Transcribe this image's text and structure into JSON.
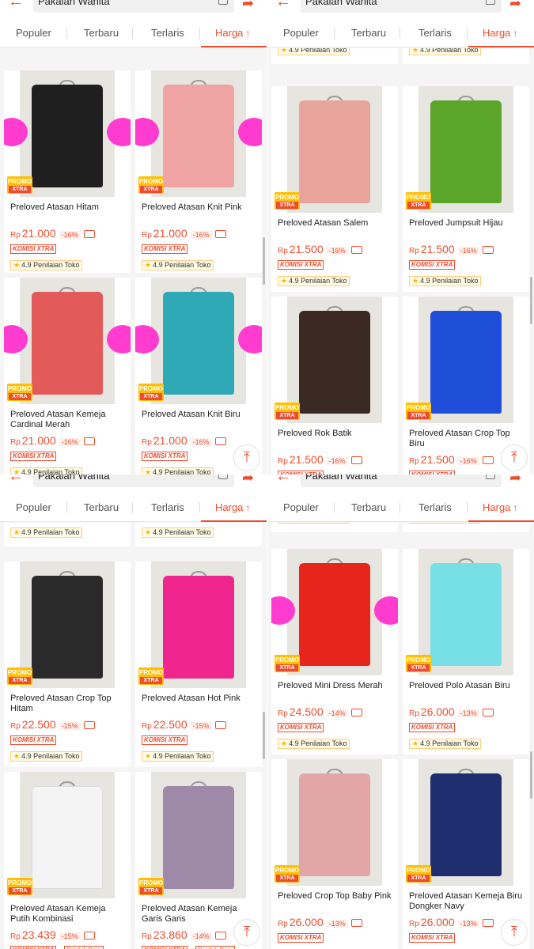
{
  "search": {
    "query": "Pakaian Wanita"
  },
  "tabs": [
    "Populer",
    "Terbaru",
    "Terlaris",
    "Harga"
  ],
  "badges": {
    "promo_top": "PROMO",
    "promo_bottom": "XTRA",
    "komisi": "KOMISI XTRA",
    "rating": "4.9 Penilaian Toko",
    "new": "Produk Baru"
  },
  "currency": "Rp",
  "colors": {
    "accent": "#ee4d2d",
    "promo": "#ffbf00",
    "star": "#ffb400"
  },
  "panels": [
    {
      "products": [
        {
          "name": "Preloved Atasan Hitam",
          "price": "21.000",
          "discount": "-16%",
          "garment": "#1f1f1f"
        },
        {
          "name": "Preloved Atasan Knit Pink",
          "price": "21.000",
          "discount": "-16%",
          "garment": "#f0a3a3"
        },
        {
          "name": "Preloved Atasan Kemeja Cardinal Merah",
          "price": "21.000",
          "discount": "-16%",
          "garment": "#e35a5a"
        },
        {
          "name": "Preloved Atasan Knit  Biru",
          "price": "21.000",
          "discount": "-16%",
          "garment": "#2ea9b5"
        }
      ]
    },
    {
      "products": [
        {
          "name": "Preloved Atasan Salem",
          "price": "21.500",
          "discount": "-16%",
          "garment": "#e8a49b"
        },
        {
          "name": "Preloved Jumpsuit Hijau",
          "price": "21.500",
          "discount": "-16%",
          "garment": "#5aa52a"
        },
        {
          "name": "Preloved Rok Batik",
          "price": "21.500",
          "discount": "-16%",
          "garment": "#3a2a22"
        },
        {
          "name": "Preloved Atasan Crop Top Biru",
          "price": "21.500",
          "discount": "-16%",
          "garment": "#1f4fd8"
        }
      ]
    },
    {
      "products": [
        {
          "name": "Preloved Atasan Crop Top Hitam",
          "price": "22.500",
          "discount": "-15%",
          "garment": "#2a2a2a"
        },
        {
          "name": "Preloved Atasan Hot Pink",
          "price": "22.500",
          "discount": "-15%",
          "garment": "#f0268f"
        },
        {
          "name": "Preloved Atasan Kemeja Putih Kombinasi",
          "price": "23.439",
          "discount": "-15%",
          "garment": "#f4f4f4"
        },
        {
          "name": "Preloved Atasan Kemeja Garis Garis",
          "price": "23.860",
          "discount": "-14%",
          "garment": "#9e8aa8"
        }
      ]
    },
    {
      "products": [
        {
          "name": "Preloved Mini Dress Merah",
          "price": "24.500",
          "discount": "-14%",
          "garment": "#e6261b"
        },
        {
          "name": "Preloved Polo Atasan Biru",
          "price": "26.000",
          "discount": "-13%",
          "garment": "#76e0e6"
        },
        {
          "name": "Preloved Crop Top Baby Pink",
          "price": "26.000",
          "discount": "-13%",
          "garment": "#e3a6a6"
        },
        {
          "name": "Preloved Atasan Kemeja Biru Dongker Navy",
          "price": "26.000",
          "discount": "-13%",
          "garment": "#1f2e6e"
        }
      ]
    }
  ]
}
